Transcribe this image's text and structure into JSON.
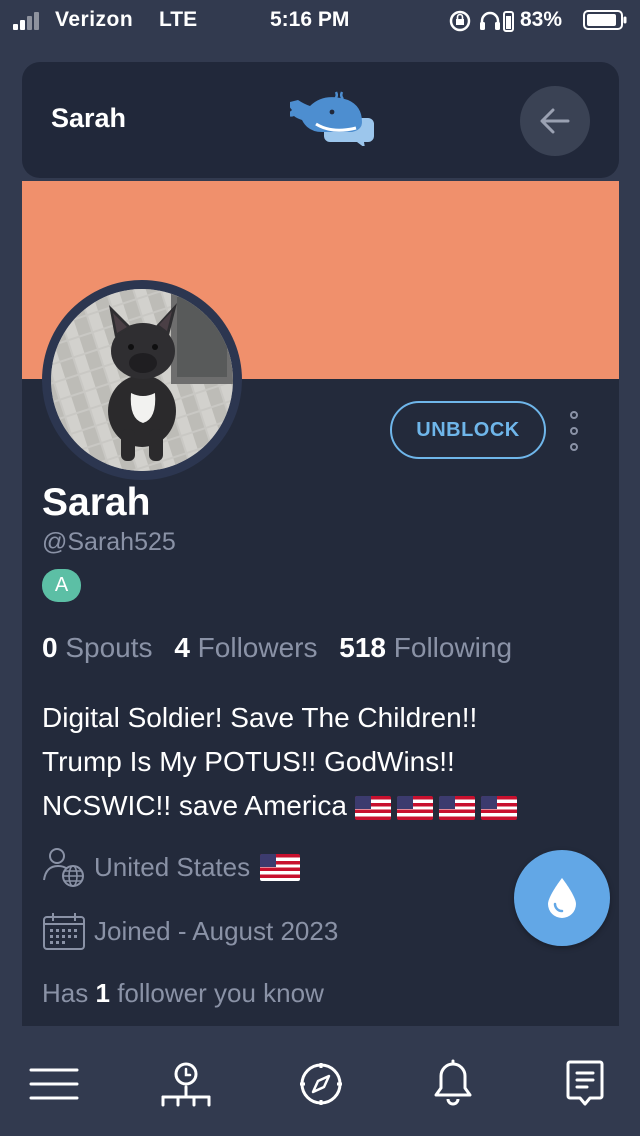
{
  "status_bar": {
    "carrier": "Verizon",
    "network": "LTE",
    "time": "5:16 PM",
    "battery_percent": "83%",
    "icons": [
      "signal-icon",
      "rotation-lock-icon",
      "headphones-icon",
      "battery-icon"
    ]
  },
  "header": {
    "title": "Sarah",
    "logo_icon": "whale-chat-logo",
    "back_icon": "arrow-left-icon"
  },
  "profile": {
    "banner_color": "#f0906c",
    "display_name": "Sarah",
    "handle": "@Sarah525",
    "badge": "A",
    "unblock_label": "UNBLOCK",
    "stats": {
      "spouts_count": "0",
      "spouts_label": "Spouts",
      "followers_count": "4",
      "followers_label": "Followers",
      "following_count": "518",
      "following_label": "Following"
    },
    "bio_line1": "Digital Soldier! Save The Children!!",
    "bio_line2": "Trump Is My POTUS!! GodWins!!",
    "bio_line3": "NCSWIC!! save America",
    "bio_flags": 4,
    "location": "United States",
    "joined": "Joined - August 2023",
    "known_prefix": "Has",
    "known_count": "1",
    "known_suffix": "follower you know"
  },
  "colors": {
    "background": "#323a4f",
    "card": "#232a3b",
    "accent": "#6fb6ea",
    "fab": "#62a7e6",
    "badge": "#5cbfa5",
    "muted_text": "#8a92a6"
  },
  "bottom_nav": {
    "items": [
      "menu-icon",
      "timeline-icon",
      "compass-icon",
      "bell-icon",
      "notes-icon"
    ]
  }
}
